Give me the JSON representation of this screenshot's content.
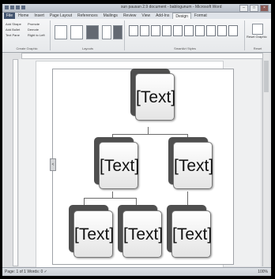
{
  "window": {
    "title": "sun pausan 2.9 document - bablogunum - Microsoft Word",
    "controls": [
      "–",
      "□",
      "×"
    ]
  },
  "tabs": [
    "File",
    "Home",
    "Insert",
    "Page Layout",
    "References",
    "Mailings",
    "Review",
    "View",
    "Add-Ins",
    "Design",
    "Format"
  ],
  "ribbon": {
    "groups": [
      "Create Graphic",
      "Layouts",
      "SmartArt Styles",
      "Reset"
    ],
    "create_graphic_items": [
      "Add Shape",
      "Add Bullet",
      "Text Pane",
      "Promote",
      "Demote",
      "Right to Left"
    ],
    "reset_label": "Reset Graphic"
  },
  "smartart": {
    "nodes": [
      {
        "label": "[Text]"
      },
      {
        "label": "[Text]"
      },
      {
        "label": "[Text]"
      },
      {
        "label": "[Text]"
      },
      {
        "label": "[Text]"
      },
      {
        "label": "[Text]"
      }
    ],
    "frame_handle": "<"
  },
  "status": {
    "left": "Page: 1 of 1   Words: 0   ✓",
    "zoom": "100%"
  }
}
